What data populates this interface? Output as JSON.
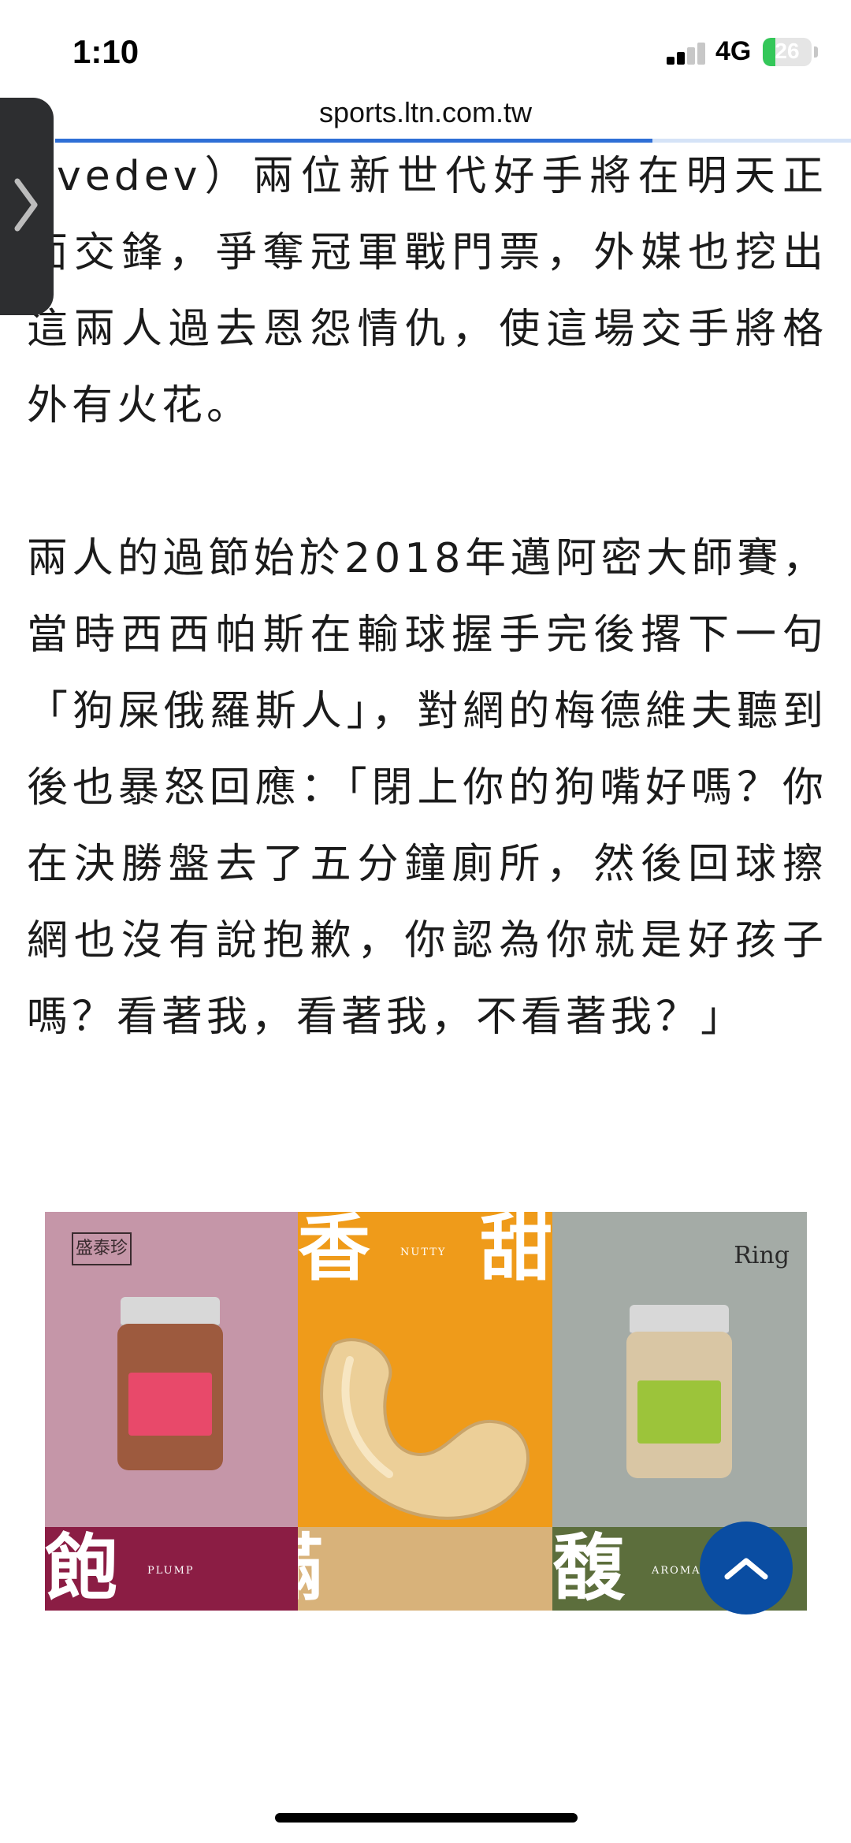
{
  "status_bar": {
    "time": "1:10",
    "network": "4G",
    "battery": "26",
    "battery_level": 0.26,
    "battery_color": "#34c759"
  },
  "browser": {
    "url": "sports.ltn.com.tw",
    "load_progress": 0.75
  },
  "article": {
    "paragraphs": [
      "dvedev）兩位新世代好手將在明天正面交鋒，爭奪冠軍戰門票，外媒也挖出這兩人過去恩怨情仇，使這場交手將格外有火花。",
      "兩人的過節始於2018年邁阿密大師賽，當時西西帕斯在輸球握手完後撂下一句「狗屎俄羅斯人」，對網的梅德維夫聽到後也暴怒回應：「閉上你的狗嘴好嗎？你在決勝盤去了五分鐘廁所，然後回球擦網也沒有說抱歉，你認為你就是好孩子嗎？看著我，看著我，不看著我？」"
    ]
  },
  "ad": {
    "brand_left": "盛泰珍",
    "brand_right": "Ring",
    "top_left_char": "香",
    "top_right_char": "甜",
    "nutty_label": "NUTTY",
    "bottom_left_char": "飽",
    "plump_label": "PLUMP",
    "bottom_mid_char": "滿",
    "bottom_right_char": "馥",
    "aroma_label": "AROMA",
    "colors": {
      "left_panel": "#c596a8",
      "middle_panel": "#ef9b1a",
      "right_panel": "#a4aba6",
      "left_strip": "#8b1d44",
      "middle_strip": "#d8b27a",
      "right_strip": "#5c6e3c"
    }
  },
  "icons": {
    "edge_tab": "chevron-right-icon",
    "scroll_top": "chevron-up-icon"
  },
  "accent_color": "#0a4da2"
}
